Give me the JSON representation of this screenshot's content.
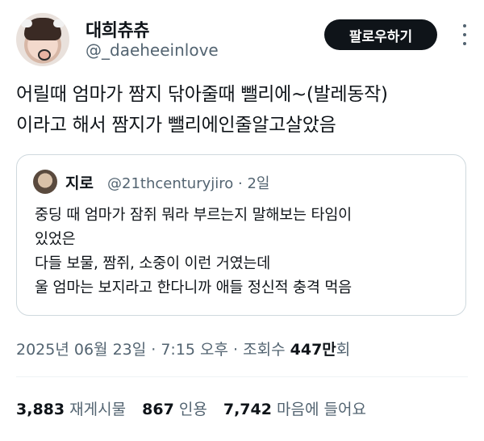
{
  "author": {
    "display_name": "대희츄츄",
    "handle": "@_daeheeinlove"
  },
  "follow_button": {
    "label": "팔로우하기"
  },
  "more_icon": "more-vertical-icon",
  "tweet": {
    "lines": [
      "어릴때 엄마가 짬지 닦아줄때 뺄리에~(발레동작)",
      "이라고 해서 짬지가 뺄리에인줄알고살았음"
    ]
  },
  "quote": {
    "display_name": "지로",
    "meta": "@21thcenturyjiro · 2일",
    "lines": [
      "중딩 때 엄마가 잠쥐 뭐라 부르는지 말해보는 타임이",
      "있었은",
      "다들 보물, 짬쥐, 소중이 이런 거였는데",
      "울 엄마는 보지라고 한다니까 애들 정신적 충격 먹음"
    ]
  },
  "timestamp": {
    "text": "2025년 06월 23일 · 7:15 오후 · 조회수 ",
    "views": "447만",
    "views_suffix": "회"
  },
  "stats": {
    "reposts_count": "3,883",
    "reposts_label": "재게시물",
    "quotes_count": "867",
    "quotes_label": "인용",
    "likes_count": "7,742",
    "likes_label": "마음에 들어요"
  }
}
